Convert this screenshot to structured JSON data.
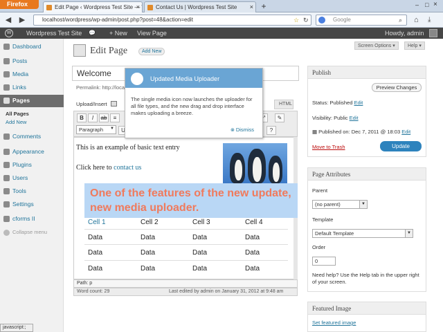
{
  "browser": {
    "menu_button": "Firefox",
    "tabs": [
      {
        "title": "Edit Page ‹ Wordpress Test Site — Wo..."
      },
      {
        "title": "Contact Us | Wordpress Test Site"
      }
    ],
    "new_tab": "+",
    "url": "localhost/wordpress/wp-admin/post.php?post=48&action=edit",
    "search_engine": "Google",
    "status_text": "javascript:;"
  },
  "adminbar": {
    "site": "Wordpress Test Site",
    "new_label": "+ New",
    "view_page": "View Page",
    "howdy": "Howdy, admin"
  },
  "sidebar": {
    "items": [
      {
        "label": "Dashboard"
      },
      {
        "label": "Posts"
      },
      {
        "label": "Media"
      },
      {
        "label": "Links"
      },
      {
        "label": "Pages"
      },
      {
        "label": "Comments"
      },
      {
        "label": "Appearance"
      },
      {
        "label": "Plugins"
      },
      {
        "label": "Users"
      },
      {
        "label": "Tools"
      },
      {
        "label": "Settings"
      },
      {
        "label": "cforms II"
      },
      {
        "label": "Collapse menu"
      }
    ],
    "subitems": [
      {
        "label": "All Pages"
      },
      {
        "label": "Add New"
      }
    ]
  },
  "main": {
    "title": "Edit Page",
    "add_new": "Add New",
    "screen_options": "Screen Options ▾",
    "help": "Help ▾",
    "post_title": "Welcome",
    "permalink": "Permalink: http://loca",
    "upload_insert": "Upload/Insert",
    "html_tab": "HTML",
    "format_select": "Paragraph",
    "editor_line1": "This is an example of basic text entry",
    "editor_line2_prefix": "Click here to",
    "editor_link": "contact us",
    "caption": "One of the features of the new update, new media uploader.",
    "table": {
      "header": [
        "Cell 1",
        "Cell 2",
        "Cell 3",
        "Cell 4"
      ],
      "rows": [
        [
          "Data",
          "Data",
          "Data",
          "Data"
        ],
        [
          "Data",
          "Data",
          "Data",
          "Data"
        ],
        [
          "Data",
          "Data",
          "Data",
          "Data"
        ]
      ]
    },
    "path": "Path: p",
    "word_count": "Word count: 29",
    "last_edited": "Last edited by admin on January 31, 2012 at 9:48 am"
  },
  "popup": {
    "title": "Updated Media Uploader",
    "body": "The single media icon now launches the uploader for all file types, and the new drag and drop interface makes uploading a breeze.",
    "dismiss": "Dismiss"
  },
  "publish": {
    "title": "Publish",
    "preview": "Preview Changes",
    "status_label": "Status: Published",
    "status_edit": "Edit",
    "visibility_label": "Visibility: Public",
    "visibility_edit": "Edit",
    "published_on": "Published on: Dec 7, 2011 @ 18:03",
    "published_edit": "Edit",
    "trash": "Move to Trash",
    "update": "Update"
  },
  "attributes": {
    "title": "Page Attributes",
    "parent_label": "Parent",
    "parent_value": "(no parent)",
    "template_label": "Template",
    "template_value": "Default Template",
    "order_label": "Order",
    "order_value": "0",
    "help_text": "Need help? Use the Help tab in the upper right of your screen."
  },
  "featured": {
    "title": "Featured Image",
    "link": "Set featured image"
  }
}
